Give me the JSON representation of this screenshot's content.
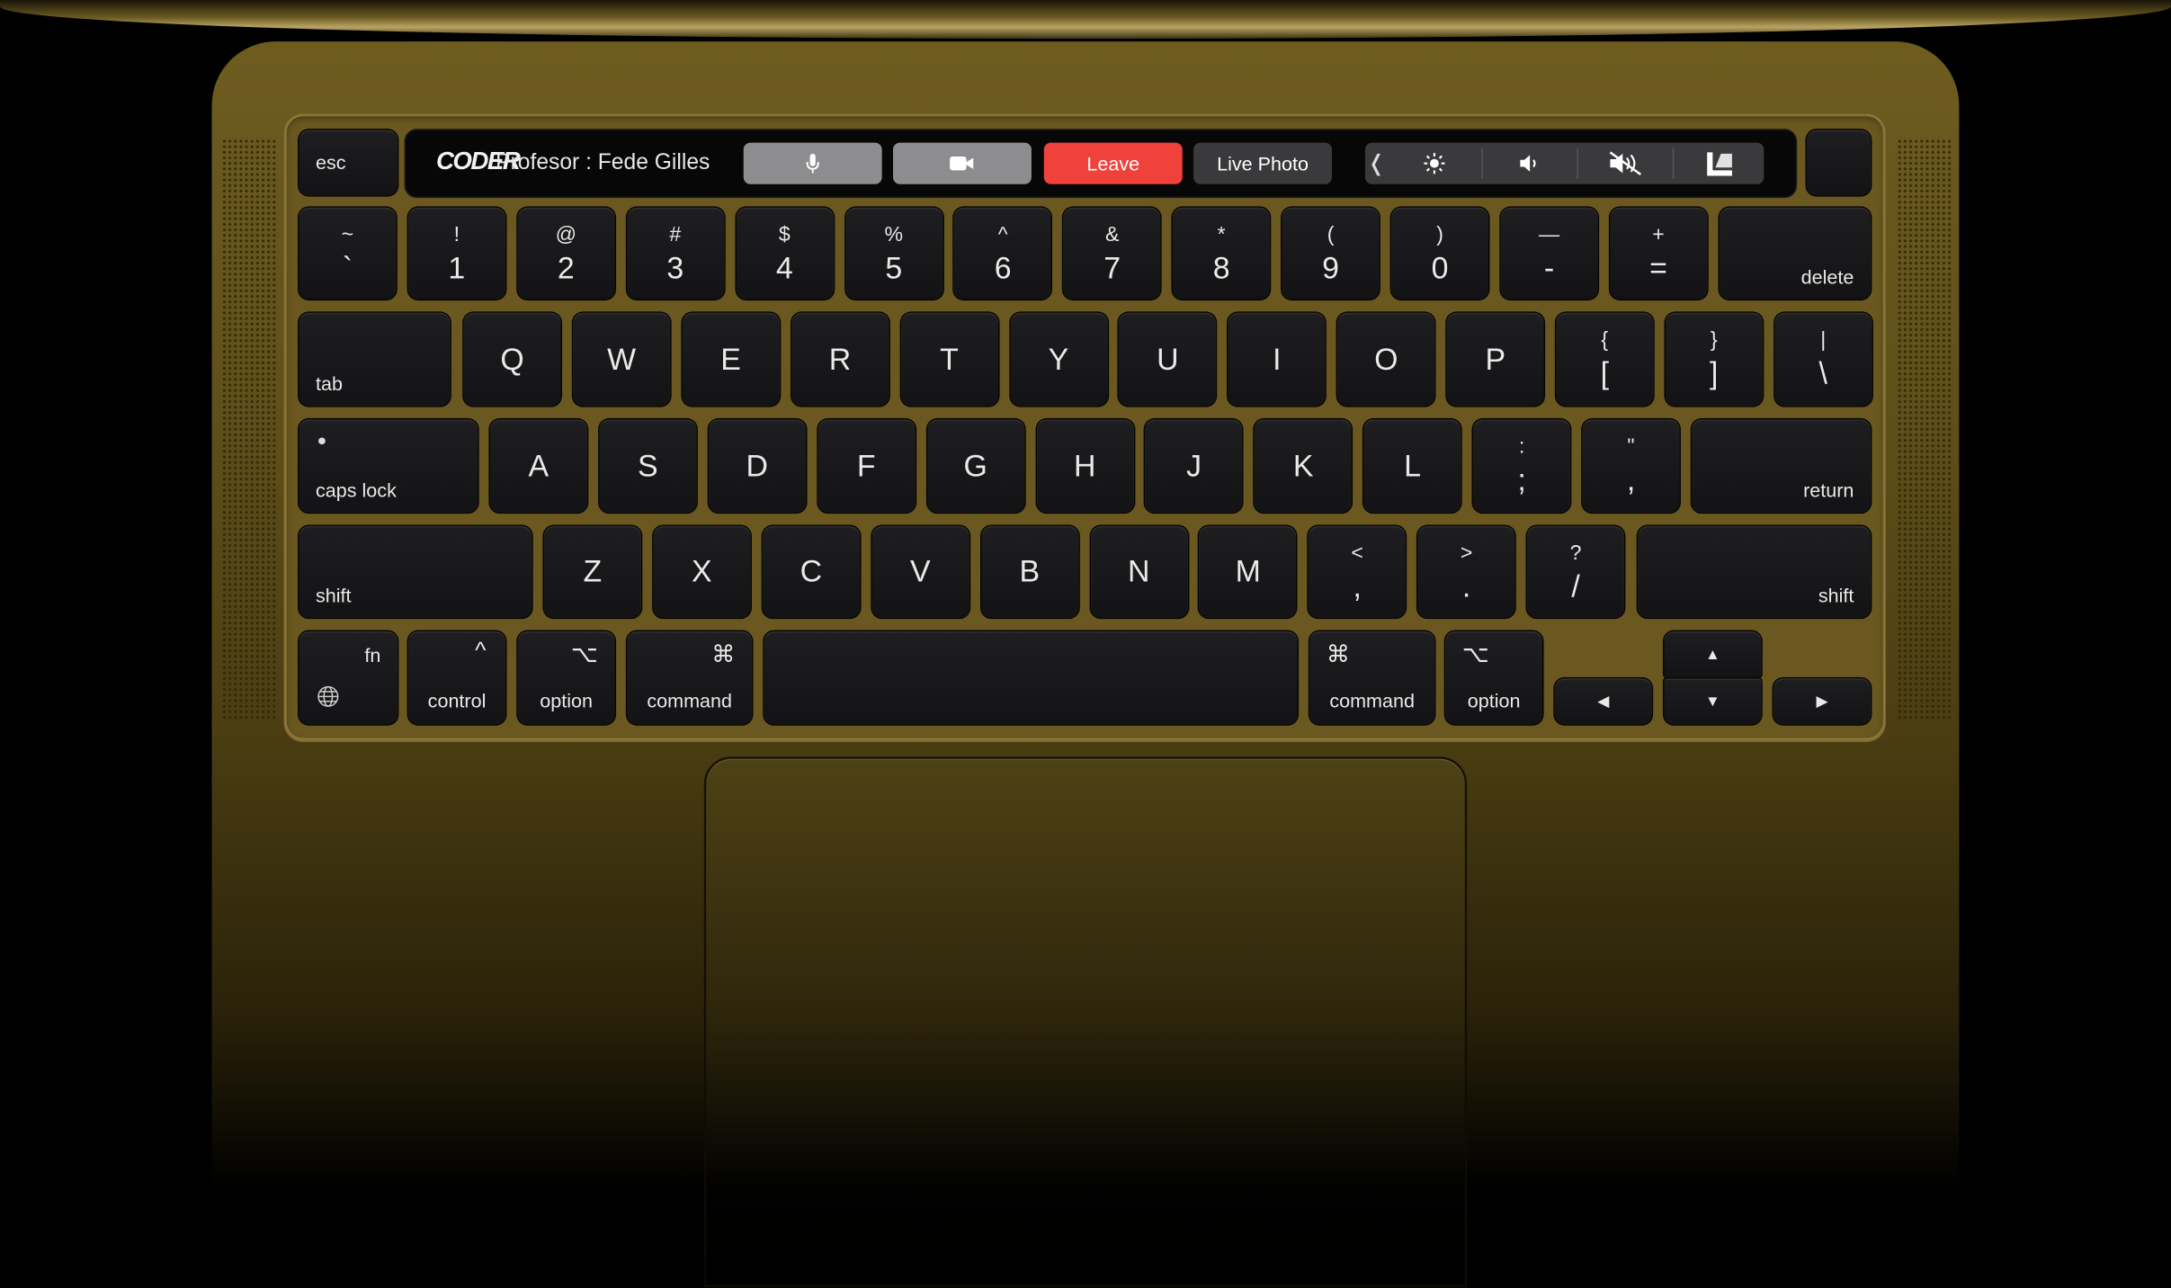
{
  "colors": {
    "body": "#5f4f1a",
    "key": "#161618",
    "leave": "#f0413a",
    "touchbar": "#070707"
  },
  "touchbar": {
    "brand": "CODER",
    "professor": "Profesor : Fede Gilles",
    "mic_icon": "microphone-icon",
    "video_icon": "video-camera-icon",
    "leave_label": "Leave",
    "live_photo_label": "Live Photo",
    "collapse_glyph": "❬",
    "brightness_icon": "brightness-icon",
    "volume_icon": "speaker-icon",
    "mute_icon": "mute-icon",
    "siri_icon": "app-logo-icon"
  },
  "keys": {
    "esc": "esc",
    "row1": [
      {
        "top": "~",
        "bot": "`"
      },
      {
        "top": "!",
        "bot": "1"
      },
      {
        "top": "@",
        "bot": "2"
      },
      {
        "top": "#",
        "bot": "3"
      },
      {
        "top": "$",
        "bot": "4"
      },
      {
        "top": "%",
        "bot": "5"
      },
      {
        "top": "^",
        "bot": "6"
      },
      {
        "top": "&",
        "bot": "7"
      },
      {
        "top": "*",
        "bot": "8"
      },
      {
        "top": "(",
        "bot": "9"
      },
      {
        "top": ")",
        "bot": "0"
      },
      {
        "top": "—",
        "bot": "-"
      },
      {
        "top": "+",
        "bot": "="
      }
    ],
    "delete": "delete",
    "tab": "tab",
    "row2": [
      "Q",
      "W",
      "E",
      "R",
      "T",
      "Y",
      "U",
      "I",
      "O",
      "P"
    ],
    "row2_sym": [
      {
        "top": "{",
        "bot": "["
      },
      {
        "top": "}",
        "bot": "]"
      },
      {
        "top": "|",
        "bot": "\\"
      }
    ],
    "caps": "caps lock",
    "row3": [
      "A",
      "S",
      "D",
      "F",
      "G",
      "H",
      "J",
      "K",
      "L"
    ],
    "row3_sym": [
      {
        "top": ":",
        "bot": ";"
      },
      {
        "top": "\"",
        "bot": ","
      }
    ],
    "return": "return",
    "shift": "shift",
    "row4": [
      "Z",
      "X",
      "C",
      "V",
      "B",
      "N",
      "M"
    ],
    "row4_sym": [
      {
        "top": "<",
        "bot": ","
      },
      {
        "top": ">",
        "bot": "."
      },
      {
        "top": "?",
        "bot": "/"
      }
    ],
    "fn": "fn",
    "control": "control",
    "control_sym": "^",
    "option": "option",
    "option_sym": "⌥",
    "command": "command",
    "command_sym": "⌘",
    "arrow_up": "▲",
    "arrow_down": "▼",
    "arrow_left": "◀",
    "arrow_right": "▶"
  }
}
